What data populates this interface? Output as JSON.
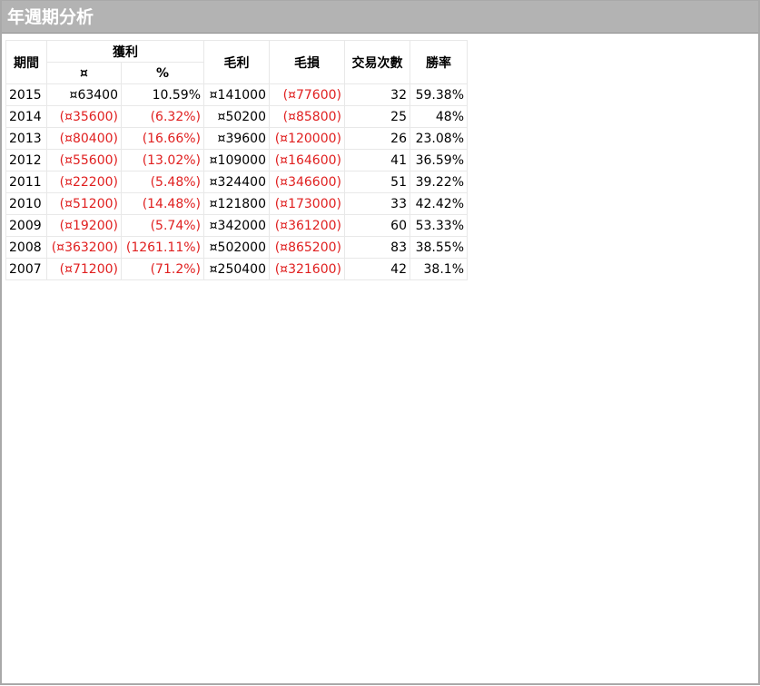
{
  "window": {
    "title": "年週期分析"
  },
  "table": {
    "headers": {
      "period": "期間",
      "profit": "獲利",
      "profit_amount": "¤",
      "profit_percent": "%",
      "gross_profit": "毛利",
      "gross_loss": "毛損",
      "trade_count": "交易次數",
      "win_rate": "勝率"
    },
    "rows": [
      {
        "year": "2015",
        "profit": "¤63400",
        "profit_neg": false,
        "percent": "10.59%",
        "percent_neg": false,
        "gross_profit": "¤141000",
        "gross_loss": "(¤77600)",
        "trades": "32",
        "win_rate": "59.38%"
      },
      {
        "year": "2014",
        "profit": "(¤35600)",
        "profit_neg": true,
        "percent": "(6.32%)",
        "percent_neg": true,
        "gross_profit": "¤50200",
        "gross_loss": "(¤85800)",
        "trades": "25",
        "win_rate": "48%"
      },
      {
        "year": "2013",
        "profit": "(¤80400)",
        "profit_neg": true,
        "percent": "(16.66%)",
        "percent_neg": true,
        "gross_profit": "¤39600",
        "gross_loss": "(¤120000)",
        "trades": "26",
        "win_rate": "23.08%"
      },
      {
        "year": "2012",
        "profit": "(¤55600)",
        "profit_neg": true,
        "percent": "(13.02%)",
        "percent_neg": true,
        "gross_profit": "¤109000",
        "gross_loss": "(¤164600)",
        "trades": "41",
        "win_rate": "36.59%"
      },
      {
        "year": "2011",
        "profit": "(¤22200)",
        "profit_neg": true,
        "percent": "(5.48%)",
        "percent_neg": true,
        "gross_profit": "¤324400",
        "gross_loss": "(¤346600)",
        "trades": "51",
        "win_rate": "39.22%"
      },
      {
        "year": "2010",
        "profit": "(¤51200)",
        "profit_neg": true,
        "percent": "(14.48%)",
        "percent_neg": true,
        "gross_profit": "¤121800",
        "gross_loss": "(¤173000)",
        "trades": "33",
        "win_rate": "42.42%"
      },
      {
        "year": "2009",
        "profit": "(¤19200)",
        "profit_neg": true,
        "percent": "(5.74%)",
        "percent_neg": true,
        "gross_profit": "¤342000",
        "gross_loss": "(¤361200)",
        "trades": "60",
        "win_rate": "53.33%"
      },
      {
        "year": "2008",
        "profit": "(¤363200)",
        "profit_neg": true,
        "percent": "(1261.11%)",
        "percent_neg": true,
        "gross_profit": "¤502000",
        "gross_loss": "(¤865200)",
        "trades": "83",
        "win_rate": "38.55%"
      },
      {
        "year": "2007",
        "profit": "(¤71200)",
        "profit_neg": true,
        "percent": "(71.2%)",
        "percent_neg": true,
        "gross_profit": "¤250400",
        "gross_loss": "(¤321600)",
        "trades": "42",
        "win_rate": "38.1%"
      }
    ]
  },
  "colors": {
    "title_bar": "#b3b3b3",
    "title_text": "#ffffff",
    "negative": "#e02020",
    "positive": "#000000",
    "grid": "#e8e8e8"
  }
}
